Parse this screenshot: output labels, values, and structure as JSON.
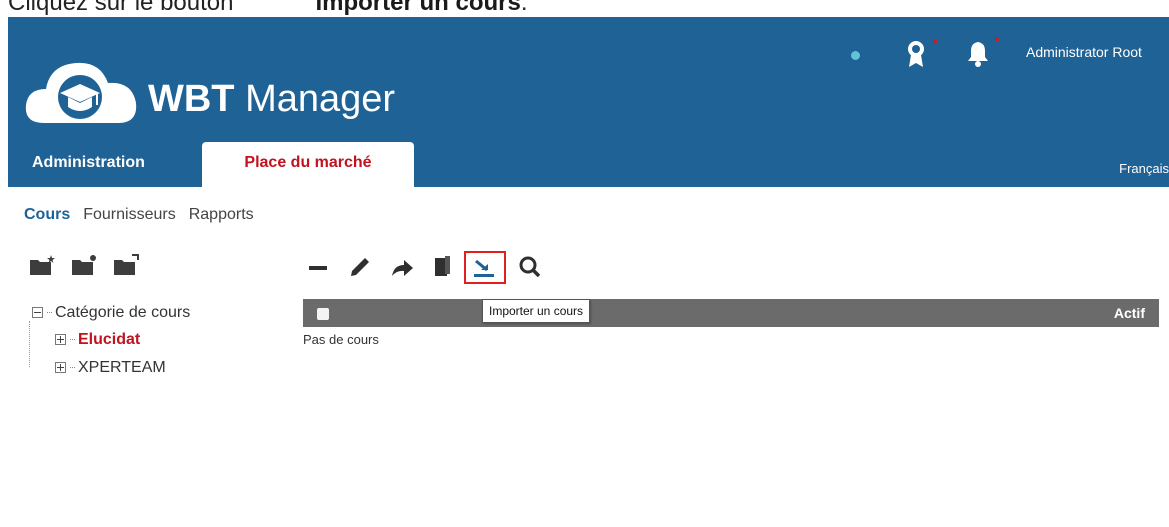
{
  "instruction": {
    "prefix": "Cliquez sur le bouton",
    "bold": "Importer un cours",
    "suffix": "."
  },
  "header": {
    "brand_bold": "WBT",
    "brand_rest": " Manager",
    "user_name": "Administrator Root",
    "language": "Français",
    "colors": {
      "background": "#1f6295",
      "status_dot": "#5fc4d8",
      "notification_dot": "#d31a1a"
    }
  },
  "tabs": [
    {
      "label": "Administration",
      "active": false
    },
    {
      "label": "Place du marché",
      "active": true
    }
  ],
  "subnav": [
    "Cours",
    "Fournisseurs",
    "Rapports"
  ],
  "folder_actions": [
    "add-folder-icon",
    "edit-folder-icon",
    "move-folder-icon"
  ],
  "tree": {
    "root": "Catégorie de cours",
    "children": [
      {
        "label": "Elucidat",
        "selected": true
      },
      {
        "label": "XPERTEAM",
        "selected": false
      }
    ]
  },
  "toolbar": {
    "icons": [
      "minus-icon",
      "pencil-icon",
      "share-arrow-icon",
      "copy-icon",
      "import-icon",
      "search-icon"
    ],
    "tooltip": "Importer un cours",
    "highlight_color": "#e01f1f"
  },
  "grid": {
    "columns": {
      "active": "Actif"
    },
    "empty": "Pas de cours"
  }
}
